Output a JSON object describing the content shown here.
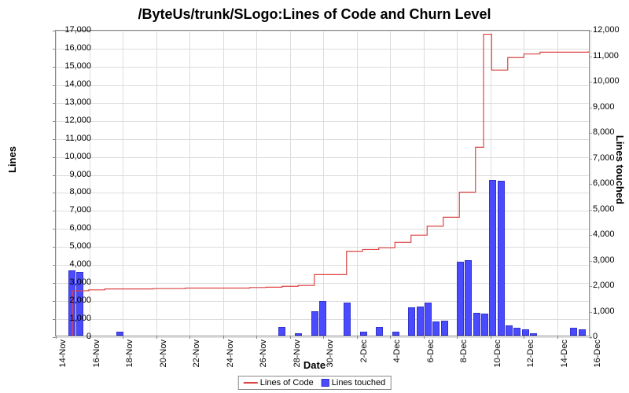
{
  "chart_data": {
    "type": "bar+line",
    "title": "/ByteUs/trunk/SLogo:Lines of Code and Churn Level",
    "xlabel": "Date",
    "ylabel_left": "Lines",
    "ylabel_right": "Lines touched",
    "ylim_left": [
      0,
      17000
    ],
    "ylim_right": [
      0,
      12000
    ],
    "x_ticks": [
      "14-Nov",
      "16-Nov",
      "18-Nov",
      "20-Nov",
      "22-Nov",
      "24-Nov",
      "26-Nov",
      "28-Nov",
      "30-Nov",
      "2-Dec",
      "4-Dec",
      "6-Dec",
      "8-Dec",
      "10-Dec",
      "12-Dec",
      "14-Dec",
      "16-Dec"
    ],
    "y_ticks_left": [
      0,
      1000,
      2000,
      3000,
      4000,
      5000,
      6000,
      7000,
      8000,
      9000,
      10000,
      11000,
      12000,
      13000,
      14000,
      15000,
      16000,
      17000
    ],
    "y_ticks_right": [
      0,
      1000,
      2000,
      3000,
      4000,
      5000,
      6000,
      7000,
      8000,
      9000,
      10000,
      11000,
      12000
    ],
    "series": [
      {
        "name": "Lines of Code",
        "kind": "line",
        "axis": "left",
        "color": "#d44",
        "data": [
          {
            "x": "15-Nov",
            "y": 2500
          },
          {
            "x": "16-Nov",
            "y": 2550
          },
          {
            "x": "17-Nov",
            "y": 2600
          },
          {
            "x": "18-Nov",
            "y": 2600
          },
          {
            "x": "20-Nov",
            "y": 2620
          },
          {
            "x": "22-Nov",
            "y": 2650
          },
          {
            "x": "24-Nov",
            "y": 2650
          },
          {
            "x": "26-Nov",
            "y": 2680
          },
          {
            "x": "27-Nov",
            "y": 2700
          },
          {
            "x": "28-Nov",
            "y": 2750
          },
          {
            "x": "29-Nov",
            "y": 2800
          },
          {
            "x": "30-Nov",
            "y": 3400
          },
          {
            "x": "1-Dec",
            "y": 4700
          },
          {
            "x": "2-Dec",
            "y": 4800
          },
          {
            "x": "3-Dec",
            "y": 4900
          },
          {
            "x": "4-Dec",
            "y": 5200
          },
          {
            "x": "5-Dec",
            "y": 5600
          },
          {
            "x": "6-Dec",
            "y": 6100
          },
          {
            "x": "7-Dec",
            "y": 6600
          },
          {
            "x": "8-Dec",
            "y": 8000
          },
          {
            "x": "9-Dec",
            "y": 10500
          },
          {
            "x": "9.5-Dec",
            "y": 16800
          },
          {
            "x": "10-Dec",
            "y": 14800
          },
          {
            "x": "11-Dec",
            "y": 15500
          },
          {
            "x": "12-Dec",
            "y": 15700
          },
          {
            "x": "13-Dec",
            "y": 15800
          },
          {
            "x": "14-Dec",
            "y": 15800
          },
          {
            "x": "15-Dec",
            "y": 15800
          },
          {
            "x": "16-Dec",
            "y": 15850
          }
        ]
      },
      {
        "name": "Lines touched",
        "kind": "bar",
        "axis": "right",
        "color": "#4a4aff",
        "data": [
          {
            "x": "15-Nov",
            "y": 2550
          },
          {
            "x": "15.5-Nov",
            "y": 2500
          },
          {
            "x": "18-Nov",
            "y": 150
          },
          {
            "x": "28-Nov",
            "y": 350
          },
          {
            "x": "29-Nov",
            "y": 100
          },
          {
            "x": "30-Nov",
            "y": 950
          },
          {
            "x": "30.5-Nov",
            "y": 1350
          },
          {
            "x": "1-Dec",
            "y": 1300
          },
          {
            "x": "2-Dec",
            "y": 150
          },
          {
            "x": "3-Dec",
            "y": 350
          },
          {
            "x": "4-Dec",
            "y": 150
          },
          {
            "x": "5-Dec",
            "y": 1100
          },
          {
            "x": "5.5-Dec",
            "y": 1150
          },
          {
            "x": "6-Dec",
            "y": 1300
          },
          {
            "x": "6.5-Dec",
            "y": 550
          },
          {
            "x": "7-Dec",
            "y": 600
          },
          {
            "x": "8-Dec",
            "y": 2900
          },
          {
            "x": "8.5-Dec",
            "y": 2950
          },
          {
            "x": "9-Dec",
            "y": 900
          },
          {
            "x": "9.5-Dec",
            "y": 850
          },
          {
            "x": "10-Dec",
            "y": 6100
          },
          {
            "x": "10.5-Dec",
            "y": 6050
          },
          {
            "x": "11-Dec",
            "y": 400
          },
          {
            "x": "11.5-Dec",
            "y": 300
          },
          {
            "x": "12-Dec",
            "y": 250
          },
          {
            "x": "12.5-Dec",
            "y": 100
          },
          {
            "x": "15-Dec",
            "y": 300
          },
          {
            "x": "15.5-Dec",
            "y": 250
          }
        ]
      }
    ],
    "legend": [
      "Lines of Code",
      "Lines touched"
    ]
  }
}
